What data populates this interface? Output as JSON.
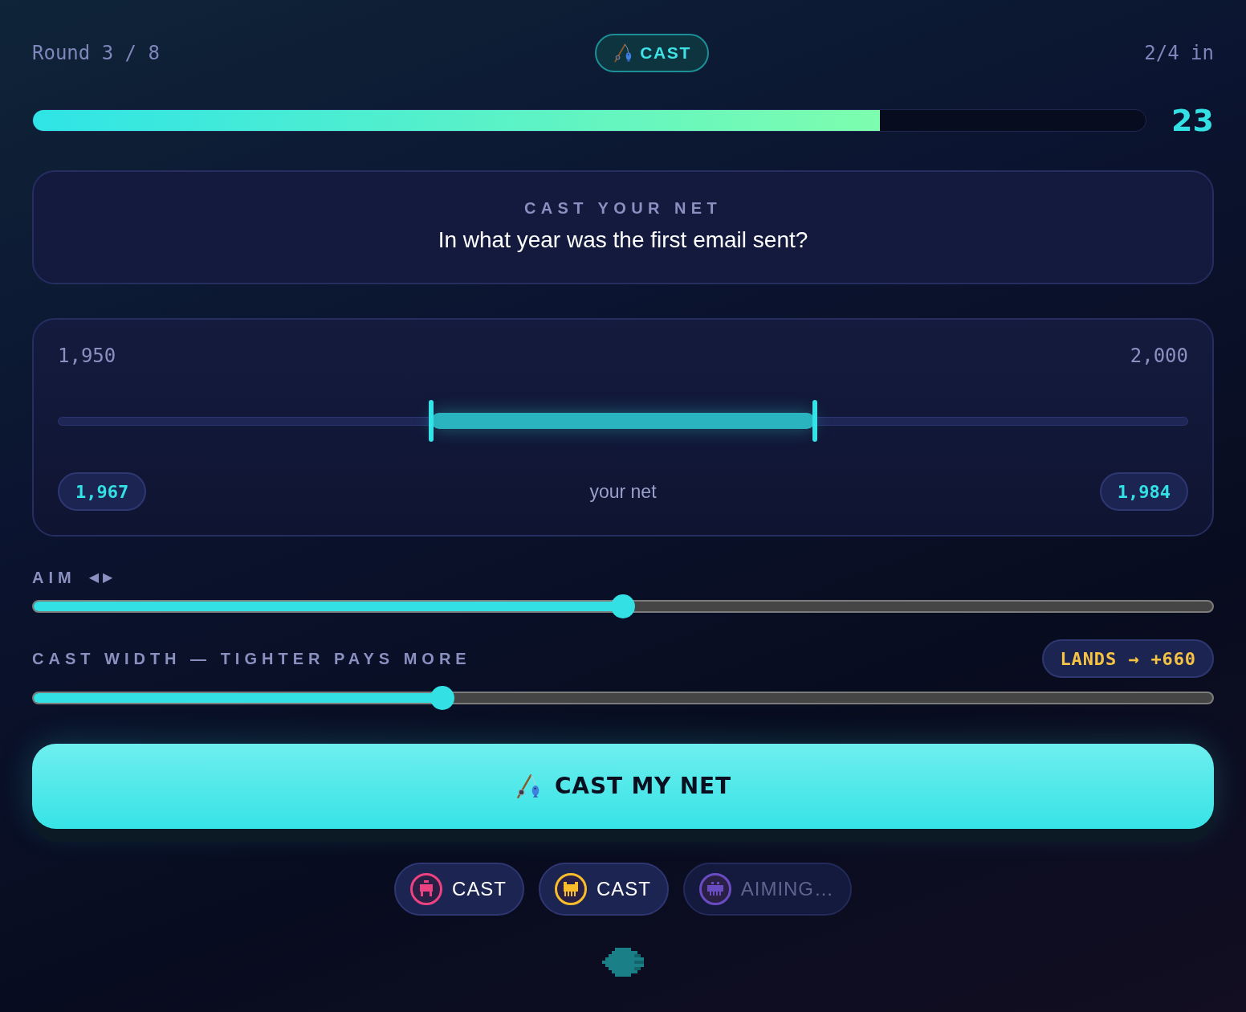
{
  "header": {
    "round": "Round 3 / 8",
    "mode": "CAST",
    "progress": "2/4 in"
  },
  "timer": {
    "level": 0.761,
    "seconds": "23"
  },
  "question": {
    "label": "CAST YOUR NET",
    "text": "In what year was the first email sent?"
  },
  "range": {
    "min": "1,950",
    "max": "2,000",
    "handles": [
      {
        "level": 0.33,
        "value": "1,967"
      },
      {
        "level": 0.67,
        "value": "1,984"
      }
    ],
    "caption": "your net"
  },
  "aim": {
    "label": "AIM",
    "arrows": "◀ ▶",
    "level": 0.5
  },
  "width": {
    "label": "CAST WIDTH — TIGHTER PAYS MORE",
    "payout": "LANDS → +660",
    "level": 0.344
  },
  "cast_button": {
    "label": "CAST MY NET"
  },
  "players": [
    {
      "color": "#ec4281",
      "status": "CAST",
      "cast": true
    },
    {
      "color": "#f9bd2c",
      "status": "CAST",
      "cast": true
    },
    {
      "color": "#6a4cc2",
      "status": "AIMING…",
      "cast": false
    }
  ]
}
